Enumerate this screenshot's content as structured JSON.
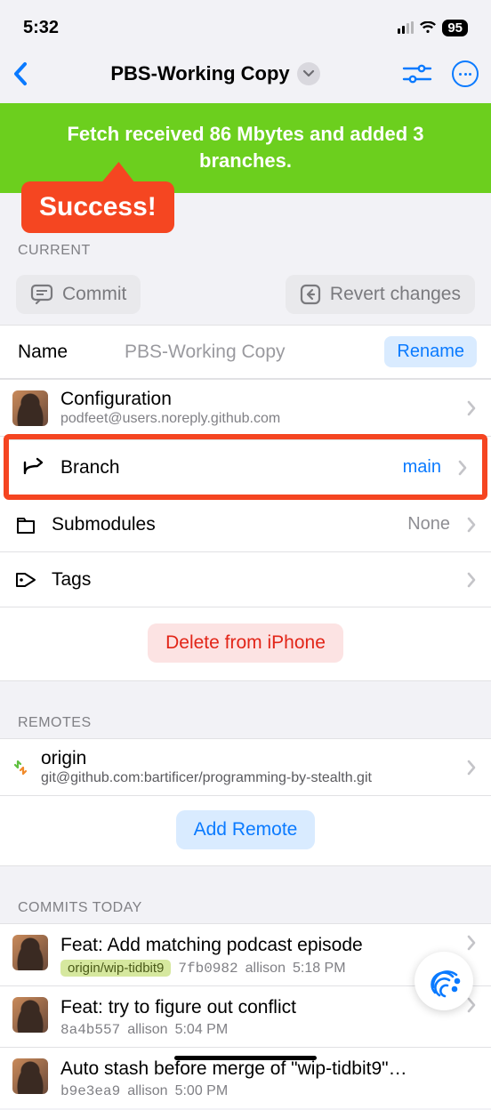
{
  "status": {
    "time": "5:32",
    "battery": "95"
  },
  "nav": {
    "title": "PBS-Working Copy"
  },
  "banner": {
    "text": "Fetch received 86 Mbytes and added 3 branches."
  },
  "annotation": {
    "success": "Success!"
  },
  "sections": {
    "current": "CURRENT",
    "remotes": "REMOTES",
    "commits_today": "COMMITS TODAY"
  },
  "actions": {
    "commit": "Commit",
    "revert": "Revert changes",
    "rename": "Rename",
    "delete": "Delete from iPhone",
    "add_remote": "Add Remote"
  },
  "name_row": {
    "label": "Name",
    "value": "PBS-Working Copy"
  },
  "rows": {
    "config": {
      "title": "Configuration",
      "sub": "podfeet@users.noreply.github.com"
    },
    "branch": {
      "title": "Branch",
      "value": "main"
    },
    "submodules": {
      "title": "Submodules",
      "value": "None"
    },
    "tags": {
      "title": "Tags"
    }
  },
  "remotes": [
    {
      "name": "origin",
      "url": "git@github.com:bartificer/programming-by-stealth.git"
    }
  ],
  "commits": [
    {
      "title": "Feat: Add matching podcast episode",
      "branch": "origin/wip-tidbit9",
      "hash": "7fb0982",
      "author": "allison",
      "time": "5:18 PM"
    },
    {
      "title": "Feat: try to figure out conflict",
      "branch": null,
      "hash": "8a4b557",
      "author": "allison",
      "time": "5:04 PM"
    },
    {
      "title": "Auto stash before merge of \"wip-tidbit9\"…",
      "branch": null,
      "hash": "b9e3ea9",
      "author": "allison",
      "time": "5:00 PM"
    }
  ]
}
